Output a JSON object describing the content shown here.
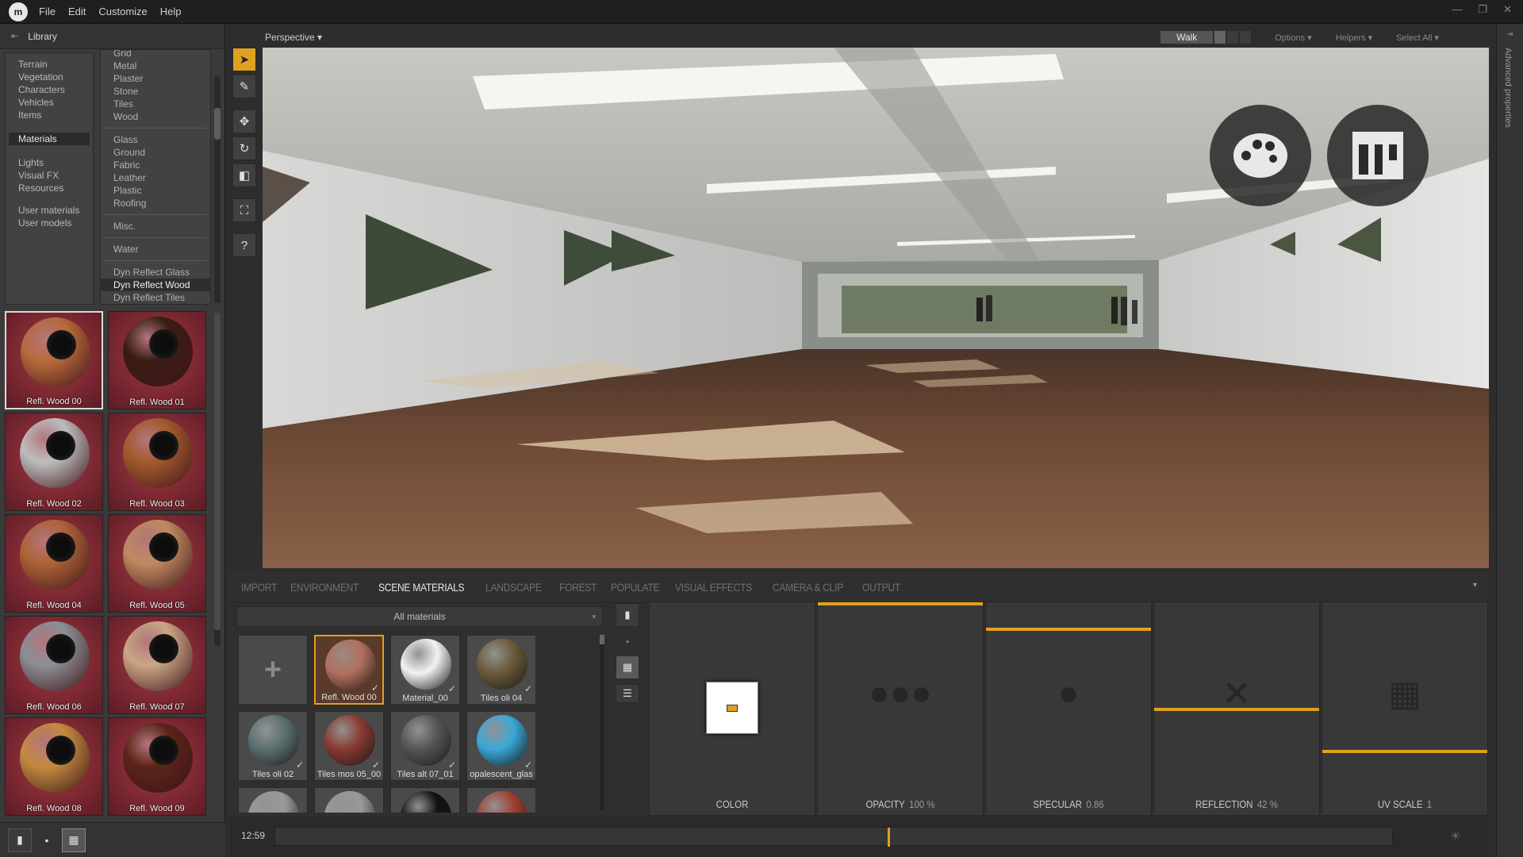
{
  "menubar": {
    "logo": "m",
    "items": [
      "File",
      "Edit",
      "Customize",
      "Help"
    ],
    "window_controls": [
      "—",
      "❐",
      "✕"
    ]
  },
  "library": {
    "title": "Library",
    "categories": [
      "Terrain",
      "Vegetation",
      "Characters",
      "Vehicles",
      "Items",
      "Materials",
      "Lights",
      "Visual FX",
      "Resources",
      "User materials",
      "User models"
    ],
    "active_category": "Materials",
    "subcategories": [
      "Grid",
      "Metal",
      "Plaster",
      "Stone",
      "Tiles",
      "Wood",
      "Glass",
      "Ground",
      "Fabric",
      "Leather",
      "Plastic",
      "Roofing",
      "Misc.",
      "Water",
      "Dyn Reflect Glass",
      "Dyn Reflect Wood",
      "Dyn Reflect Tiles"
    ],
    "active_subcategory": "Dyn Reflect Wood",
    "materials": [
      {
        "label": "Refl. Wood 00",
        "color": "#b86a3a"
      },
      {
        "label": "Refl. Wood 01",
        "color": "#3a1d14"
      },
      {
        "label": "Refl. Wood 02",
        "color": "#bdbdbd"
      },
      {
        "label": "Refl. Wood 03",
        "color": "#a25a2c"
      },
      {
        "label": "Refl. Wood 04",
        "color": "#ad6336"
      },
      {
        "label": "Refl. Wood 05",
        "color": "#c08a60"
      },
      {
        "label": "Refl. Wood 06",
        "color": "#8a8f95"
      },
      {
        "label": "Refl. Wood 07",
        "color": "#c9a684"
      },
      {
        "label": "Refl. Wood 08",
        "color": "#c38a3e"
      },
      {
        "label": "Refl. Wood 09",
        "color": "#5a2418"
      }
    ]
  },
  "viewport": {
    "view_mode": "Perspective ▾",
    "walk_label": "Walk",
    "options_label": "Options ▾",
    "helpers_label": "Helpers ▾",
    "select_all_label": "Select All ▾"
  },
  "advanced_properties_label": "Advanced properties",
  "bottom_tabs": [
    "IMPORT",
    "ENVIRONMENT",
    "SCENE MATERIALS",
    "LANDSCAPE",
    "FOREST",
    "POPULATE",
    "VISUAL EFFECTS",
    "CAMERA & CLIP",
    "OUTPUT"
  ],
  "active_tab": "SCENE MATERIALS",
  "scene_materials": {
    "filter_label": "All materials",
    "add_symbol": "+",
    "items": [
      {
        "label": "Refl. Wood 00",
        "color": "#b07060"
      },
      {
        "label": "Material_00",
        "color": "#f2f2f2"
      },
      {
        "label": "Tiles oli 04",
        "color": "#6b5a3a"
      },
      {
        "label": "Tiles oli 02",
        "color": "#5a7070"
      },
      {
        "label": "Tiles mos 05_00",
        "color": "#8a3a30"
      },
      {
        "label": "Tiles alt 07_01",
        "color": "#555"
      },
      {
        "label": "opalescent_glas",
        "color": "#3aa8d8"
      },
      {
        "label": "",
        "color": "#999"
      },
      {
        "label": "",
        "color": "#999"
      },
      {
        "label": "",
        "color": "#111"
      },
      {
        "label": "",
        "color": "#a04030"
      }
    ]
  },
  "properties": {
    "color_label": "COLOR",
    "opacity_label": "OPACITY",
    "opacity_value": "100 %",
    "opacity_level": 1.0,
    "specular_label": "SPECULAR",
    "specular_value": "0.86",
    "specular_level": 0.86,
    "reflection_label": "REFLECTION",
    "reflection_value": "42 %",
    "reflection_level": 0.42,
    "uvscale_label": "UV SCALE",
    "uvscale_value": "1",
    "accent_color": "#e0a120"
  },
  "timeline": {
    "time": "12:59"
  }
}
